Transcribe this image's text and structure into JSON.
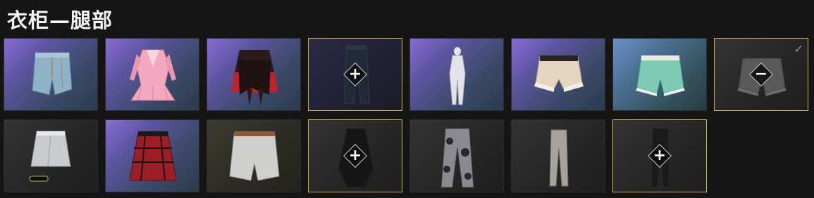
{
  "title": "衣柜—腿部",
  "tiles": [
    {
      "name": "denim-shorts",
      "bg": "purple",
      "icon": "denim-shorts-icon",
      "state": "normal"
    },
    {
      "name": "pink-jacket-skirt-outfit",
      "bg": "purple",
      "icon": "pink-outfit-icon",
      "state": "normal"
    },
    {
      "name": "black-red-layered-skirt",
      "bg": "purple",
      "icon": "black-red-skirt-icon",
      "state": "normal"
    },
    {
      "name": "dark-jeans",
      "bg": "darkp",
      "icon": "dark-jeans-icon",
      "state": "add"
    },
    {
      "name": "white-bodysuit",
      "bg": "purple",
      "icon": "white-bodysuit-icon",
      "state": "normal"
    },
    {
      "name": "cream-bloomers",
      "bg": "purple",
      "icon": "cream-bloomers-icon",
      "state": "normal"
    },
    {
      "name": "mint-ruffle-shorts",
      "bg": "teal",
      "icon": "mint-shorts-icon",
      "state": "normal"
    },
    {
      "name": "gray-ruffle-shorts",
      "bg": "gray",
      "icon": "gray-shorts-icon",
      "state": "remove",
      "checked": true
    },
    {
      "name": "silver-mini-skirt",
      "bg": "gray",
      "icon": "silver-skirt-icon",
      "state": "normal"
    },
    {
      "name": "red-plaid-skirt",
      "bg": "purple",
      "icon": "plaid-skirt-icon",
      "state": "normal"
    },
    {
      "name": "white-shorts-belt",
      "bg": "olive",
      "icon": "white-shorts-icon",
      "state": "normal"
    },
    {
      "name": "black-hooded-piece",
      "bg": "gray",
      "icon": "black-hood-icon",
      "state": "add"
    },
    {
      "name": "camo-cargo-pants",
      "bg": "gray",
      "icon": "camo-pants-icon",
      "state": "normal"
    },
    {
      "name": "gray-leggings",
      "bg": "gray",
      "icon": "gray-leggings-icon",
      "state": "normal"
    },
    {
      "name": "black-leggings",
      "bg": "gray",
      "icon": "black-leggings-icon",
      "state": "add"
    },
    {
      "name": "empty-slot",
      "bg": "empty",
      "icon": "",
      "state": "empty"
    }
  ],
  "glyphs": {
    "add": "+",
    "remove": "−",
    "check": "✓"
  },
  "colors": {
    "selected_border": "#cdb75e",
    "background": "#151515"
  }
}
